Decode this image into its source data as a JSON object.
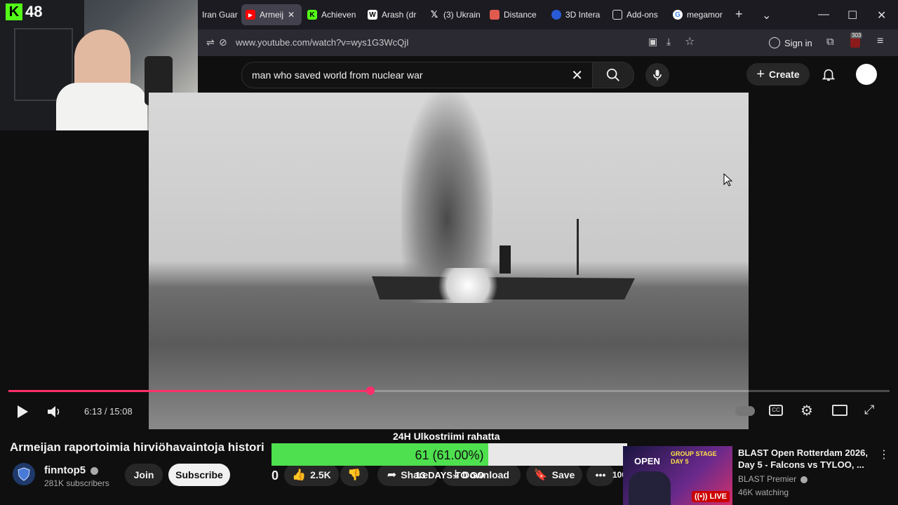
{
  "webcam": {
    "kick_count": "48"
  },
  "tabs": [
    {
      "label": "Iran Guar",
      "favicon": "document-icon",
      "active": false
    },
    {
      "label": "Armeij",
      "favicon": "youtube-icon",
      "active": true
    },
    {
      "label": "Achieven",
      "favicon": "kick-icon",
      "active": false
    },
    {
      "label": "Arash (dr",
      "favicon": "wikipedia-icon",
      "active": false
    },
    {
      "label": "(3) Ukrain",
      "favicon": "x-icon",
      "active": false
    },
    {
      "label": "Distance",
      "favicon": "map-icon",
      "active": false
    },
    {
      "label": "3D Intera",
      "favicon": "globe-icon",
      "active": false
    },
    {
      "label": "Add-ons",
      "favicon": "puzzle-icon",
      "active": false
    },
    {
      "label": "megamor",
      "favicon": "google-icon",
      "active": false
    }
  ],
  "urlbar": {
    "url": "www.youtube.com/watch?v=wys1G3WcQjI",
    "signin": "Sign in",
    "badge": "303"
  },
  "youtube": {
    "search_value": "man who saved world from nuclear war",
    "create_label": "Create"
  },
  "player": {
    "time": "6:13 / 15:08",
    "progress": 0.411
  },
  "video": {
    "title": "Armeijan raportoimia hirviöhavaintoja histori",
    "channel": "finntop5",
    "subscribers": "281K subscribers",
    "join_label": "Join",
    "subscribe_label": "Subscribe",
    "like_count": "2.5K",
    "share_label": "Share",
    "download_label": "Download",
    "save_label": "Save",
    "left_count": "0",
    "right_count": "100"
  },
  "overlay": {
    "goal_title": "24H Ulkostriimi rahatta",
    "goal_text": "61 (61.00%)",
    "goal_fraction": 0.61,
    "days_text": "13 DAYS TO GO"
  },
  "side_video": {
    "title": "BLAST Open Rotterdam 2026, Day 5 - Falcons vs TYLOO, ...",
    "channel": "BLAST Premier",
    "watching": "46K watching",
    "live_label": "LIVE",
    "thumb_text": "GROUP STAGE DAY 5",
    "thumb_logo": "OPEN"
  },
  "colors": {
    "accent": "#ff2e6a",
    "goal": "#4ee04e",
    "kick": "#53fc18"
  }
}
